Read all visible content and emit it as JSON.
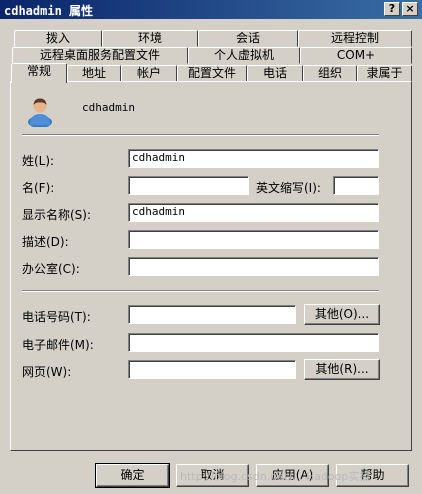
{
  "window": {
    "title": "cdhadmin 属性",
    "help": "?",
    "close": "×"
  },
  "tabs_row1": [
    "拨入",
    "环境",
    "会话",
    "远程控制"
  ],
  "tabs_row2": [
    "远程桌面服务配置文件",
    "个人虚拟机",
    "COM+"
  ],
  "tabs_row3": [
    "常规",
    "地址",
    "帐户",
    "配置文件",
    "电话",
    "组织",
    "隶属于"
  ],
  "general": {
    "display_name_header": "cdhadmin",
    "surname_label": "姓(L):",
    "surname_value": "cdhadmin",
    "given_label": "名(F):",
    "given_value": "",
    "initials_label": "英文缩写(I):",
    "initials_value": "",
    "display_label": "显示名称(S):",
    "display_value": "cdhadmin",
    "desc_label": "描述(D):",
    "desc_value": "",
    "office_label": "办公室(C):",
    "office_value": "",
    "phone_label": "电话号码(T):",
    "phone_value": "",
    "phone_other": "其他(O)...",
    "email_label": "电子邮件(M):",
    "email_value": "",
    "web_label": "网页(W):",
    "web_value": "",
    "web_other": "其他(R)..."
  },
  "buttons": {
    "ok": "确定",
    "cancel": "取消",
    "apply": "应用(A)",
    "help": "帮助"
  },
  "watermark": "http://blog.csdn.net/... Hadoop实操"
}
